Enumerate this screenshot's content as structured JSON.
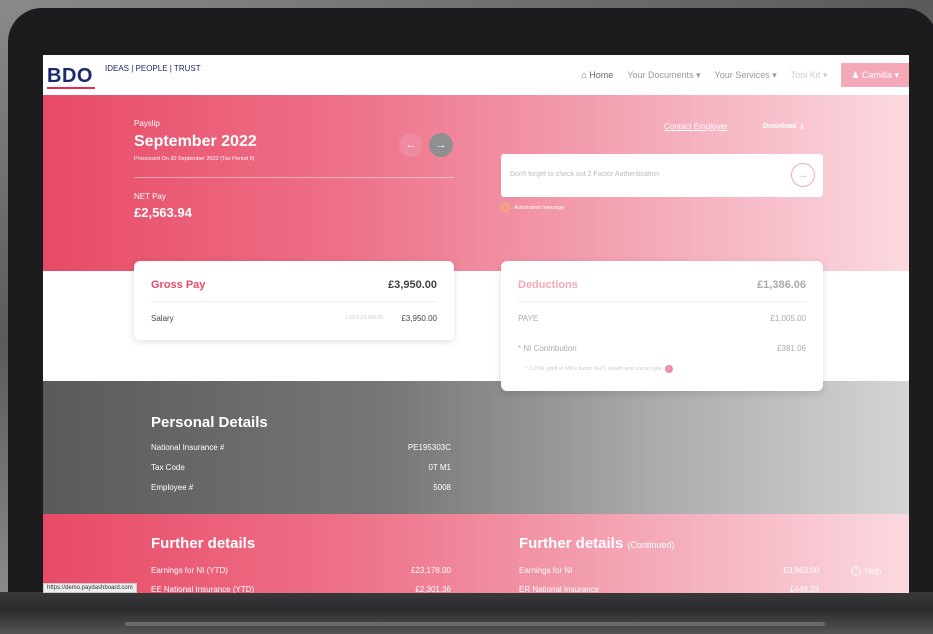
{
  "nav": {
    "logo": "BDO",
    "tagline": "IDEAS | PEOPLE | TRUST",
    "home": "Home",
    "documents": "Your Documents",
    "services": "Your Services",
    "toolkit": "Tool Kit",
    "user": "Camilla"
  },
  "hero": {
    "label": "Payslip",
    "month": "September 2022",
    "processed": "Processed On 30 September 2022 (Tax Period 6)",
    "net_label": "NET Pay",
    "net_value": "£2,563.94",
    "contact": "Contact Employer",
    "download": "Download",
    "notice": "Don't forget to check out 2 Factor Authentication",
    "automated": "Automated message"
  },
  "gross": {
    "title": "Gross Pay",
    "total": "£3,950.00",
    "rows": [
      {
        "label": "Salary",
        "qty": "1.00 X £3,950.00",
        "value": "£3,950.00"
      }
    ]
  },
  "deductions": {
    "title": "Deductions",
    "total": "£1,386.06",
    "rows": [
      {
        "label": "PAYE",
        "value": "£1,005.00"
      },
      {
        "label": "* NI Contribution",
        "value": "£381.06"
      }
    ],
    "note": "* 1.25% uplift in NICs funds NHS, health and social care"
  },
  "personal": {
    "title": "Personal Details",
    "rows": [
      {
        "label": "National Insurance #",
        "value": "PE195303C"
      },
      {
        "label": "Tax Code",
        "value": "0T M1"
      },
      {
        "label": "Employee #",
        "value": "5008"
      }
    ]
  },
  "further": {
    "title": "Further details",
    "title2": "Further details",
    "continued": "(Continued)",
    "left": [
      {
        "label": "Earnings for NI (YTD)",
        "value": "£23,178.00"
      },
      {
        "label": "EE National Insurance (YTD)",
        "value": "£2,301.36"
      }
    ],
    "right": [
      {
        "label": "Earnings for NI",
        "value": "£3,863.00"
      },
      {
        "label": "ER National Insurance",
        "value": "£448.23"
      }
    ],
    "help": "Help"
  },
  "status_url": "https://demo.paydashboard.com"
}
